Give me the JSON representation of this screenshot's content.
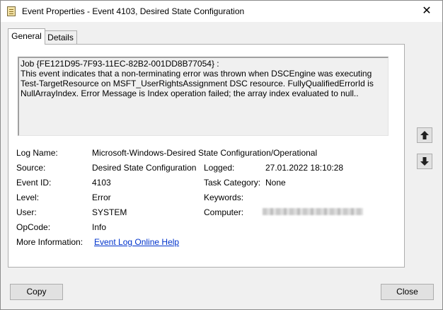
{
  "window": {
    "title": "Event Properties - Event 4103, Desired State Configuration",
    "close_glyph": "✕"
  },
  "tabs": [
    {
      "label": "General",
      "selected": true
    },
    {
      "label": "Details",
      "selected": false
    }
  ],
  "description": {
    "lines": [
      "Job {FE121D95-7F93-11EC-82B2-001DD8B77054} :",
      "This event indicates that a non-terminating error was thrown when DSCEngine was executing",
      "Test-TargetResource on MSFT_UserRightsAssignment DSC resource. FullyQualifiedErrorId is",
      "NullArrayIndex. Error Message is Index operation failed; the array index evaluated to null.."
    ]
  },
  "fields": {
    "log_name": {
      "label": "Log Name:",
      "value": "Microsoft-Windows-Desired State Configuration/Operational"
    },
    "source": {
      "label": "Source:",
      "value": "Desired State Configuration"
    },
    "logged": {
      "label": "Logged:",
      "value": "27.01.2022 18:10:28"
    },
    "event_id": {
      "label": "Event ID:",
      "value": "4103"
    },
    "task_category": {
      "label": "Task Category:",
      "value": "None"
    },
    "level": {
      "label": "Level:",
      "value": "Error"
    },
    "keywords": {
      "label": "Keywords:",
      "value": ""
    },
    "user": {
      "label": "User:",
      "value": "SYSTEM"
    },
    "computer": {
      "label": "Computer:",
      "value": ""
    },
    "opcode": {
      "label": "OpCode:",
      "value": "Info"
    },
    "more_info": {
      "label": "More Information:",
      "link": "Event Log Online Help"
    }
  },
  "side_buttons": {
    "up_icon": "arrow-up-icon",
    "down_icon": "arrow-down-icon"
  },
  "buttons": {
    "copy": "Copy",
    "close": "Close"
  },
  "colors": {
    "link": "#0033cc",
    "background": "#f0f0f0",
    "panel": "#ffffff"
  }
}
